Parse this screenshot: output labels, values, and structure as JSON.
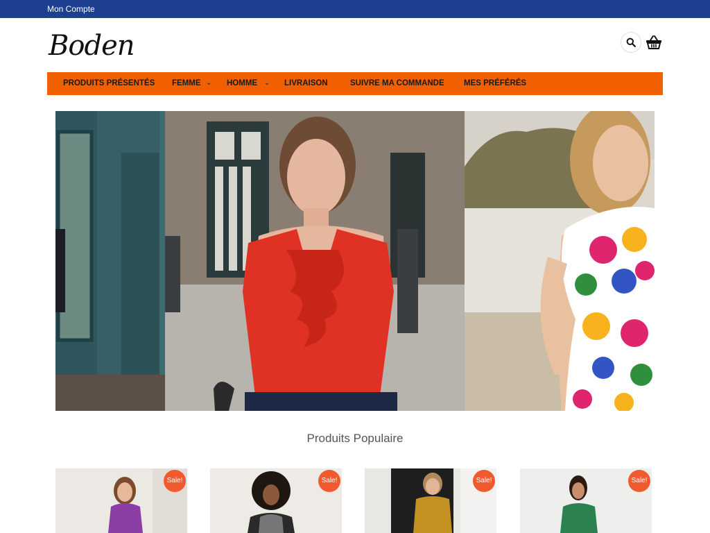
{
  "topbar": {
    "account_label": "Mon Compte",
    "bg_color": "#1e3f8f"
  },
  "header": {
    "logo_text": "Boden",
    "search_icon": "search-icon",
    "cart_icon": "basket-icon"
  },
  "nav": {
    "bg_color": "#f06000",
    "items": [
      {
        "label": "PRODUITS PRÉSENTÉS",
        "has_dropdown": false
      },
      {
        "label": "FEMME",
        "has_dropdown": true
      },
      {
        "label": "HOMME",
        "has_dropdown": true
      },
      {
        "label": "LIVRAISON",
        "has_dropdown": false
      },
      {
        "label": "SUIVRE MA COMMANDE",
        "has_dropdown": false
      },
      {
        "label": "MES PRÉFÉRÉS",
        "has_dropdown": false
      }
    ],
    "caret": "⌄"
  },
  "hero": {
    "slides": [
      "woman-in-teal-doorway",
      "woman-in-red-ruffle-top",
      "woman-in-floral-dress-on-beach"
    ]
  },
  "popular": {
    "title": "Produits Populaire",
    "products": [
      {
        "name": "purple-top-model",
        "badge": "Sale!"
      },
      {
        "name": "grey-black-top-model",
        "badge": "Sale!"
      },
      {
        "name": "mustard-dress-model",
        "badge": "Sale!"
      },
      {
        "name": "green-dress-model",
        "badge": "Sale!"
      }
    ]
  }
}
